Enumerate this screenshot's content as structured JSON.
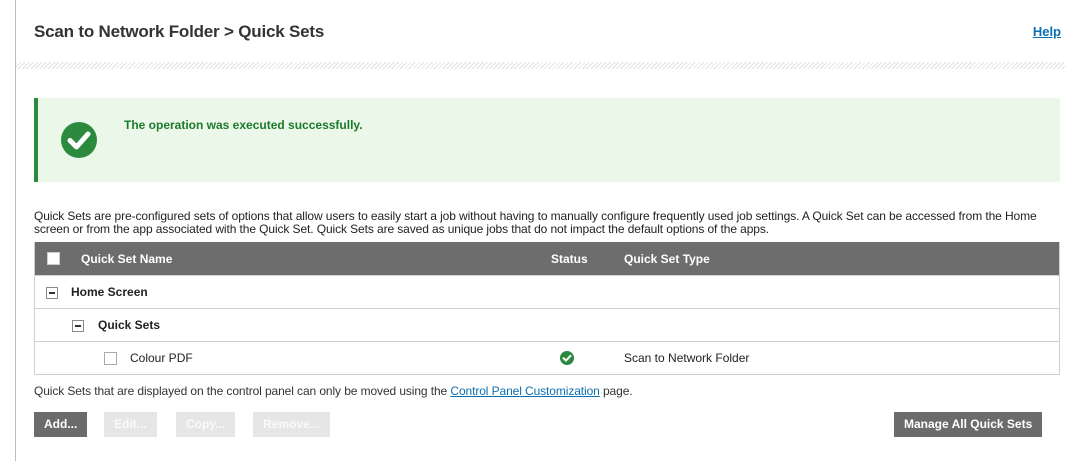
{
  "header": {
    "title": "Scan to Network Folder > Quick Sets",
    "help": "Help"
  },
  "alert": {
    "message": "The operation was executed successfully.",
    "icon": "check-circle-icon",
    "color": "#2b8a3e"
  },
  "description": "Quick Sets are pre-configured sets of options that allow users to easily start a job without having to manually configure frequently used job settings. A Quick Set can be accessed from the Home screen or from the app associated with the Quick Set. Quick Sets are saved as unique jobs that do not impact the default options of the apps.",
  "table": {
    "columns": {
      "name": "Quick Set Name",
      "status": "Status",
      "type": "Quick Set Type"
    },
    "rows": [
      {
        "label": "Home Screen"
      },
      {
        "label": "Quick Sets"
      },
      {
        "label": "Colour PDF",
        "type": "Scan to Network Folder"
      }
    ]
  },
  "note": {
    "prefix": "Quick Sets that are displayed on the control panel can only be moved using the ",
    "link": "Control Panel Customization",
    "suffix": " page."
  },
  "buttons": {
    "add": "Add...",
    "edit": "Edit...",
    "copy": "Copy...",
    "remove": "Remove...",
    "manage_all": "Manage All Quick Sets"
  }
}
